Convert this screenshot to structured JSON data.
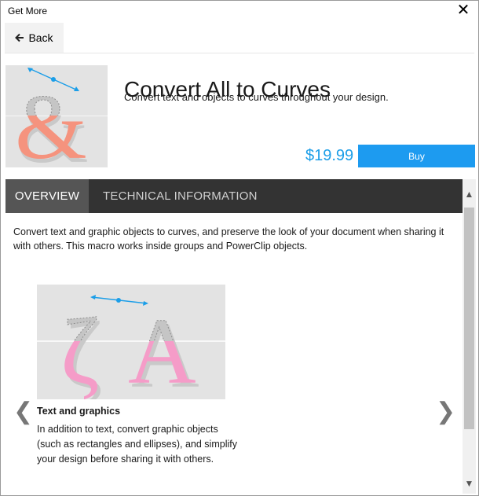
{
  "window": {
    "title": "Get More",
    "close_glyph": "✕"
  },
  "nav": {
    "back_label": "Back",
    "back_icon": "arrow-left-icon"
  },
  "product": {
    "title": "Convert All to Curves",
    "subtitle": "Convert text and objects to curves throughout your design.",
    "price": "$19.99",
    "buy_label": "Buy"
  },
  "tabs": [
    {
      "label": "OVERVIEW",
      "active": true
    },
    {
      "label": "TECHNICAL INFORMATION",
      "active": false
    }
  ],
  "overview": {
    "description": "Convert text and graphic objects to curves, and preserve the look of your document when sharing it with others. This macro works inside groups and PowerClip objects.",
    "slide": {
      "title": "Text and graphics",
      "text": "In addition to text, convert graphic objects (such as rectangles and ellipses), and simplify your design before sharing it with others."
    }
  },
  "colors": {
    "accent": "#1d9bf0",
    "price": "#1b9ee8",
    "tab_bar": "#333333",
    "tab_active": "#555555",
    "hero_fill": "#f5937e",
    "slide_fill": "#f59cc8",
    "outline_gray": "#a5a5a5"
  }
}
